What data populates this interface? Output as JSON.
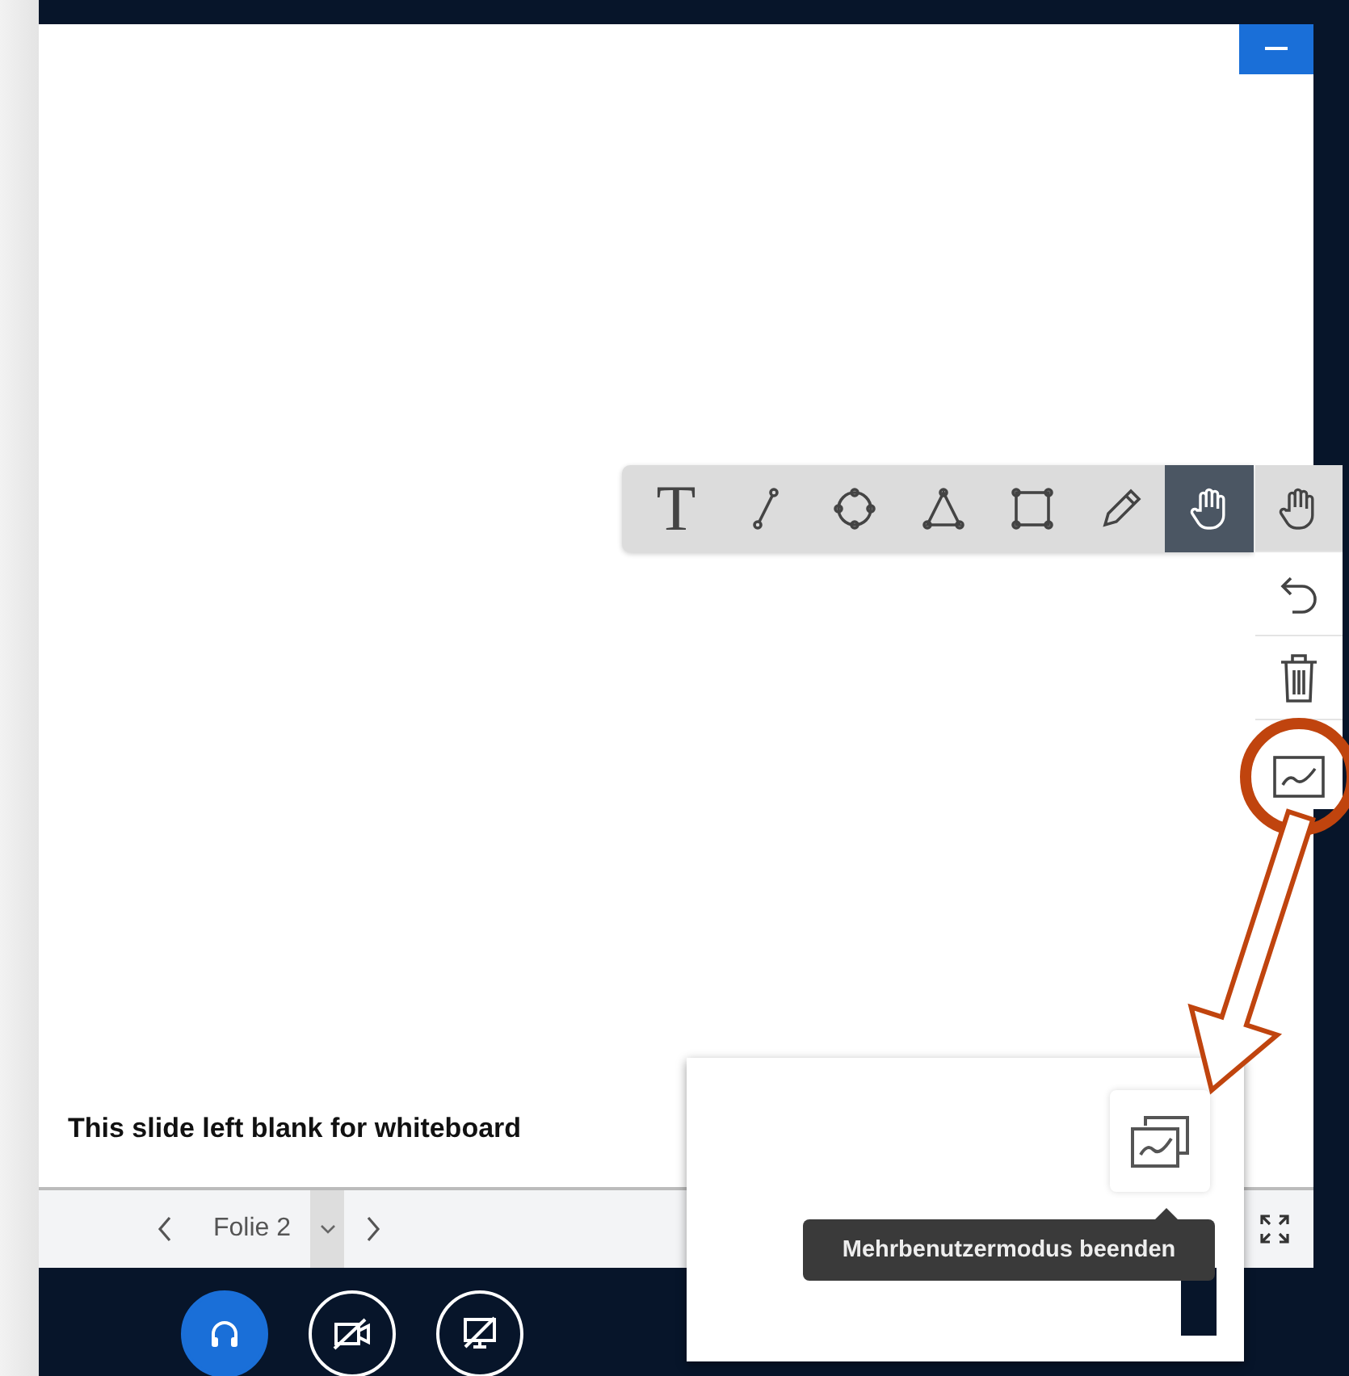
{
  "slide": {
    "text": "This slide left blank for whiteboard"
  },
  "toolbar": {
    "tools": [
      {
        "kind": "text",
        "label": "T",
        "selected": false
      },
      {
        "kind": "line",
        "selected": false
      },
      {
        "kind": "ellipse",
        "selected": false
      },
      {
        "kind": "triangle",
        "selected": false
      },
      {
        "kind": "rectangle",
        "selected": false
      },
      {
        "kind": "pencil",
        "selected": false
      },
      {
        "kind": "hand",
        "selected": true
      }
    ]
  },
  "side_tools": [
    {
      "kind": "hand"
    },
    {
      "kind": "undo"
    },
    {
      "kind": "trash"
    },
    {
      "kind": "multi_user"
    }
  ],
  "navigation": {
    "slide_label": "Folie 2"
  },
  "media_buttons": [
    {
      "kind": "audio",
      "on": true
    },
    {
      "kind": "video",
      "on": false
    },
    {
      "kind": "screen",
      "on": false
    }
  ],
  "inset": {
    "tooltip": "Mehrbenutzermodus beenden"
  }
}
